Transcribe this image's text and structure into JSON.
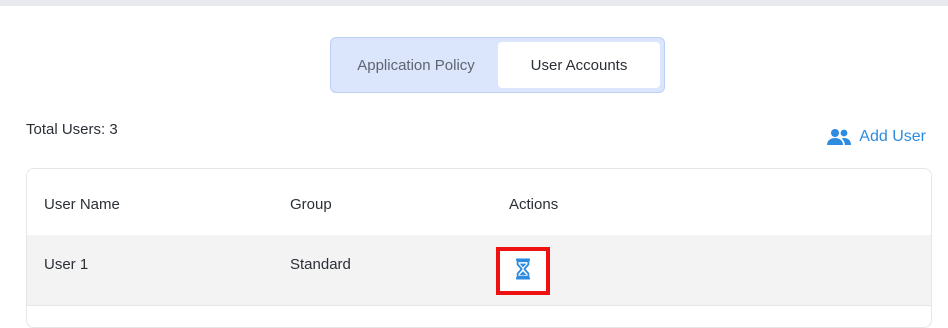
{
  "tabs": [
    {
      "label": "Application Policy",
      "active": false
    },
    {
      "label": "User Accounts",
      "active": true
    }
  ],
  "summary": {
    "total_users": "Total Users: 3"
  },
  "add_user": {
    "label": "Add User",
    "icon": "add-user-icon"
  },
  "table": {
    "headers": [
      "User Name",
      "Group",
      "Actions"
    ],
    "rows": [
      {
        "user_name": "User 1",
        "group": "Standard",
        "action_icon": "hourglass-icon"
      }
    ]
  },
  "colors": {
    "accent": "#2d8be0",
    "tab_bg": "#dbe5fb",
    "highlight": "#ee1111"
  }
}
